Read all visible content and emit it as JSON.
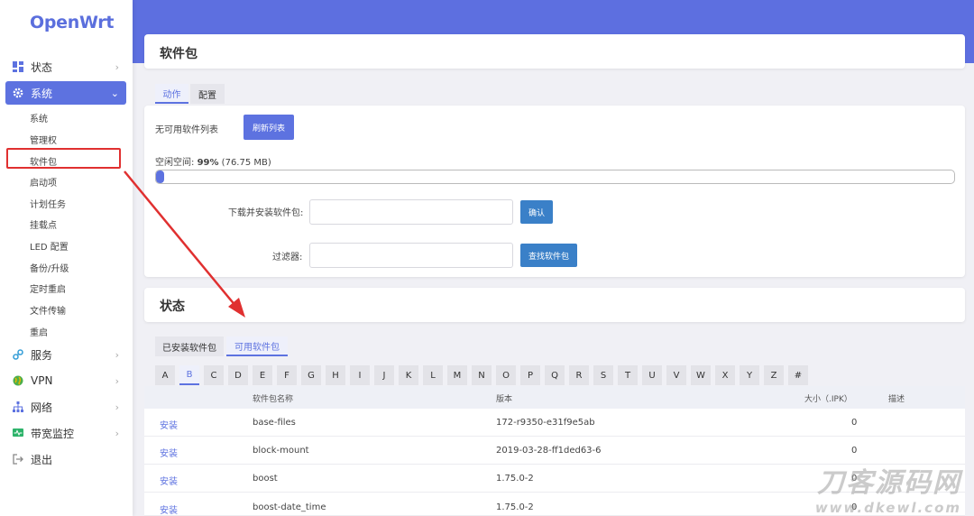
{
  "app": {
    "logo": "OpenWrt"
  },
  "colors": {
    "accent": "#5d72e0",
    "topband": "#5d6fe0",
    "arrow": "#e03030"
  },
  "sidebar": {
    "items": [
      {
        "label": "状态",
        "icon": "dashboard-icon"
      },
      {
        "label": "系统",
        "icon": "gear-icon"
      },
      {
        "label": "服务",
        "icon": "link-icon"
      },
      {
        "label": "VPN",
        "icon": "globe-icon"
      },
      {
        "label": "网络",
        "icon": "network-icon"
      },
      {
        "label": "带宽监控",
        "icon": "monitor-icon"
      },
      {
        "label": "退出",
        "icon": "logout-icon"
      }
    ],
    "system_sub": [
      "系统",
      "管理权",
      "软件包",
      "启动项",
      "计划任务",
      "挂载点",
      "LED 配置",
      "备份/升级",
      "定时重启",
      "文件传输",
      "重启"
    ]
  },
  "page": {
    "title": "软件包"
  },
  "actions": {
    "tabs": [
      "动作",
      "配置"
    ],
    "no_list": "无可用软件列表",
    "refresh_button": "刷新列表",
    "free_space_prefix": "空闲空间: ",
    "free_space_value": "99%",
    "free_space_suffix": " (76.75 MB)",
    "free_space_percent": 99,
    "download_label": "下载并安装软件包:",
    "confirm_button": "确认",
    "filter_label": "过滤器:",
    "find_button": "查找软件包"
  },
  "status": {
    "title": "状态",
    "tabs": [
      "已安装软件包",
      "可用软件包"
    ],
    "letters": [
      "A",
      "B",
      "C",
      "D",
      "E",
      "F",
      "G",
      "H",
      "I",
      "J",
      "K",
      "L",
      "M",
      "N",
      "O",
      "P",
      "Q",
      "R",
      "S",
      "T",
      "U",
      "V",
      "W",
      "X",
      "Y",
      "Z",
      "#"
    ],
    "columns": {
      "name": "软件包名称",
      "version": "版本",
      "size": "大小（.IPK）",
      "desc": "描述"
    },
    "rows": [
      {
        "action": "安装",
        "name": "base-files",
        "version": "172-r9350-e31f9e5ab",
        "size": "0"
      },
      {
        "action": "安装",
        "name": "block-mount",
        "version": "2019-03-28-ff1ded63-6",
        "size": "0"
      },
      {
        "action": "安装",
        "name": "boost",
        "version": "1.75.0-2",
        "size": "0"
      },
      {
        "action": "安装",
        "name": "boost-date_time",
        "version": "1.75.0-2",
        "size": "0"
      }
    ]
  },
  "watermark": {
    "cn": "刀客源码网",
    "en": "www.dkewl.com"
  }
}
